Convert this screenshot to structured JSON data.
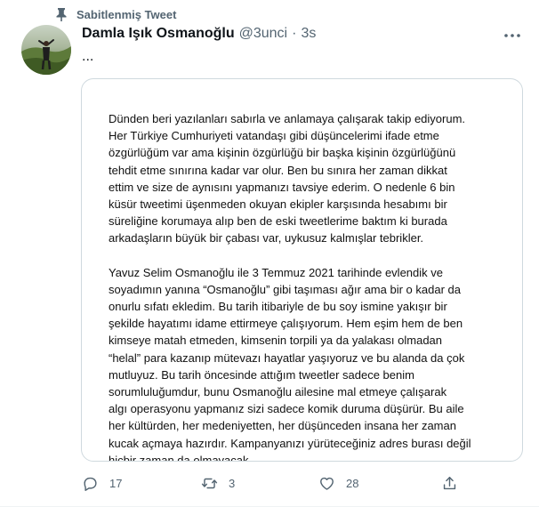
{
  "pinned": {
    "label": "Sabitlenmiş Tweet",
    "icon": "pin-icon"
  },
  "author": {
    "display_name": "Damla Işık Osmanoğlu",
    "handle": "@3unci",
    "separator": "·",
    "time": "3s"
  },
  "tweet": {
    "text": "...",
    "image_paragraphs": [
      "Dünden beri yazılanları sabırla ve anlamaya çalışarak takip ediyorum.\nHer Türkiye Cumhuriyeti vatandaşı gibi düşüncelerimi ifade etme\nözgürlüğüm var ama kişinin özgürlüğü bir başka kişinin özgürlüğünü\ntehdit etme sınırına kadar var olur. Ben bu sınıra her zaman dikkat\nettim ve size de aynısını yapmanızı tavsiye ederim. O nedenle 6 bin\nküsür tweetimi üşenmeden okuyan ekipler karşısında hesabımı bir\nsüreliğine korumaya alıp ben de eski tweetlerime baktım ki burada\narkadaşların büyük bir çabası var, uykusuz kalmışlar tebrikler.",
      "Yavuz Selim Osmanoğlu ile 3 Temmuz 2021 tarihinde evlendik ve\nsoyadımın yanına “Osmanoğlu” gibi taşıması ağır ama bir o kadar da\nonurlu sıfatı ekledim. Bu tarih itibariyle de bu soy ismine yakışır bir\nşekilde hayatımı idame ettirmeye çalışıyorum. Hem eşim hem de ben\nkimseye matah etmeden, kimsenin torpili ya da yalakası olmadan\n“helal” para kazanıp mütevazı hayatlar yaşıyoruz ve bu alanda da çok\nmutluyuz. Bu tarih öncesinde attığım tweetler sadece benim\nsorumluluğumdur, bunu Osmanoğlu ailesine mal etmeye çalışarak\nalgı operasyonu yapmanız sizi sadece komik duruma düşürür. Bu aile\nher kültürden, her medeniyetten, her düşünceden insana her zaman\nkucak açmaya hazırdır. Kampanyanızı yürüteceğiniz adres burası değil\nhiçbir zaman da olmayacak."
    ]
  },
  "actions": {
    "reply": {
      "icon": "reply-icon",
      "count": "17"
    },
    "retweet": {
      "icon": "retweet-icon",
      "count": "3"
    },
    "like": {
      "icon": "heart-icon",
      "count": "28"
    },
    "share": {
      "icon": "share-icon",
      "count": ""
    }
  },
  "colors": {
    "text_primary": "#0f1419",
    "text_secondary": "#536471",
    "border": "#cfd9de"
  }
}
